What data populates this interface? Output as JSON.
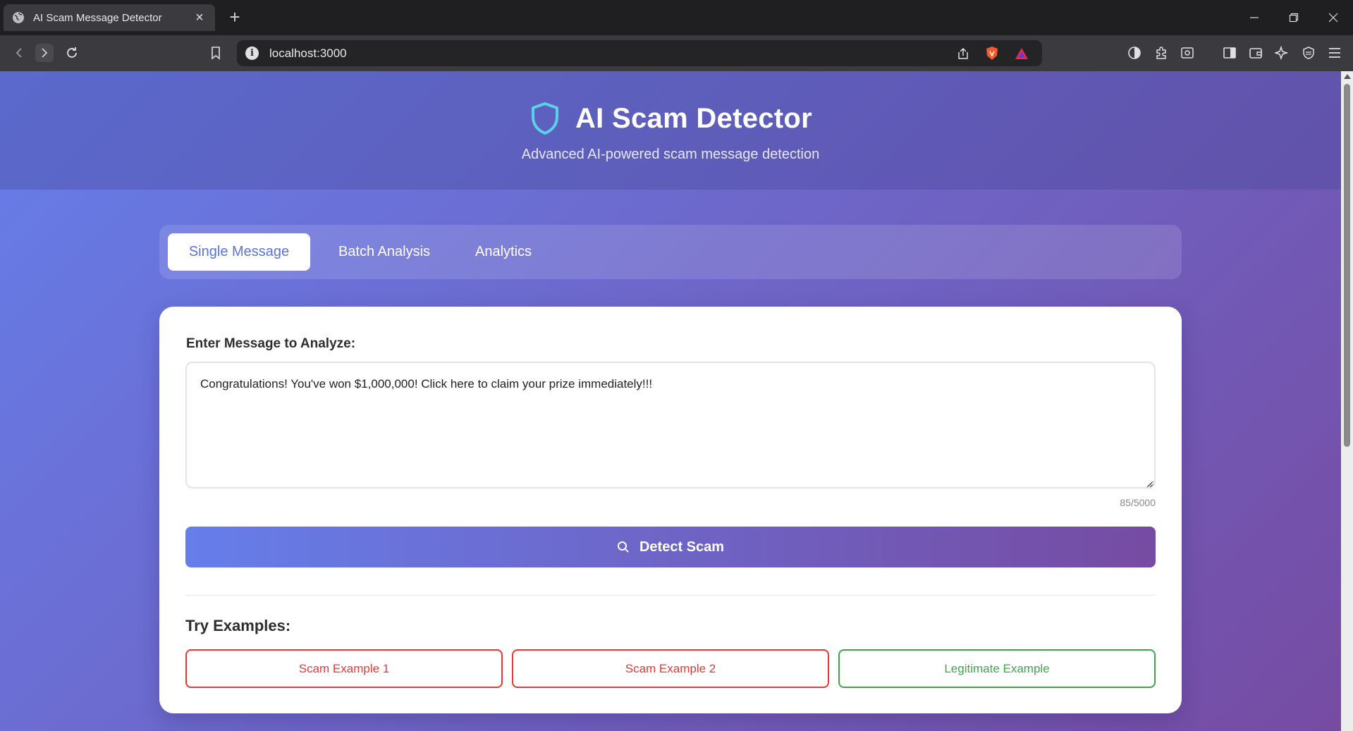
{
  "browser": {
    "tab_title": "AI Scam Message Detector",
    "url": "localhost:3000"
  },
  "header": {
    "title": "AI Scam Detector",
    "subtitle": "Advanced AI-powered scam message detection"
  },
  "nav": {
    "tabs": [
      {
        "label": "Single Message",
        "active": true
      },
      {
        "label": "Batch Analysis",
        "active": false
      },
      {
        "label": "Analytics",
        "active": false
      }
    ]
  },
  "form": {
    "label": "Enter Message to Analyze:",
    "message": "Congratulations! You've won $1,000,000! Click here to claim your prize immediately!!!",
    "char_count": "85/5000",
    "detect_label": "Detect Scam"
  },
  "examples": {
    "title": "Try Examples:",
    "buttons": [
      {
        "label": "Scam Example 1",
        "kind": "scam"
      },
      {
        "label": "Scam Example 2",
        "kind": "scam"
      },
      {
        "label": "Legitimate Example",
        "kind": "legitimate"
      }
    ]
  },
  "colors": {
    "gradient_start": "#667eea",
    "gradient_end": "#764ba2",
    "scam": "#e53935",
    "legitimate": "#3aa84a",
    "shield": "#5ad1e6"
  }
}
